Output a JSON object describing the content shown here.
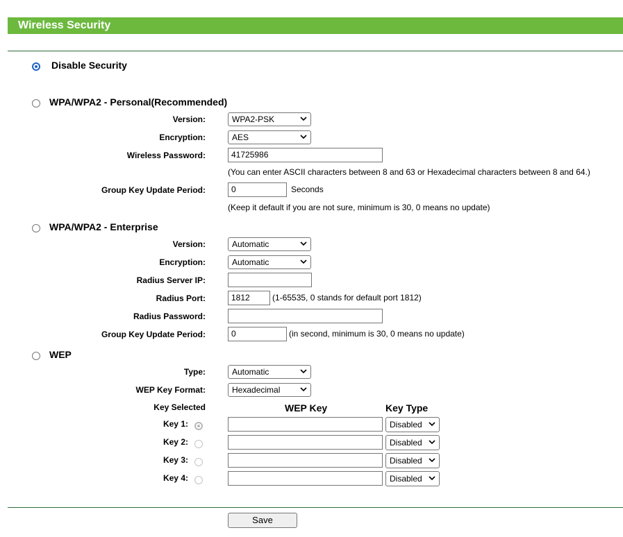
{
  "title": "Wireless Security",
  "disable": {
    "label": "Disable Security",
    "checked": true
  },
  "personal": {
    "label": "WPA/WPA2 - Personal(Recommended)",
    "version_label": "Version:",
    "version_value": "WPA2-PSK",
    "encryption_label": "Encryption:",
    "encryption_value": "AES",
    "password_label": "Wireless Password:",
    "password_value": "41725986",
    "password_note": "(You can enter ASCII characters between 8 and 63 or Hexadecimal characters between 8 and 64.)",
    "gkup_label": "Group Key Update Period:",
    "gkup_value": "0",
    "gkup_unit": "Seconds",
    "gkup_note": "(Keep it default if you are not sure, minimum is 30, 0 means no update)"
  },
  "enterprise": {
    "label": "WPA/WPA2 - Enterprise",
    "version_label": "Version:",
    "version_value": "Automatic",
    "encryption_label": "Encryption:",
    "encryption_value": "Automatic",
    "radius_ip_label": "Radius Server IP:",
    "radius_ip_value": "",
    "radius_port_label": "Radius Port:",
    "radius_port_value": "1812",
    "radius_port_note": "(1-65535, 0 stands for default port 1812)",
    "radius_pw_label": "Radius Password:",
    "radius_pw_value": "",
    "gkup_label": "Group Key Update Period:",
    "gkup_value": "0",
    "gkup_note": "(in second, minimum is 30, 0 means no update)"
  },
  "wep": {
    "label": "WEP",
    "type_label": "Type:",
    "type_value": "Automatic",
    "format_label": "WEP Key Format:",
    "format_value": "Hexadecimal",
    "key_selected_header": "Key Selected",
    "wep_key_header": "WEP Key",
    "key_type_header": "Key Type",
    "keys": [
      {
        "label": "Key 1:",
        "value": "",
        "type": "Disabled",
        "selected": true
      },
      {
        "label": "Key 2:",
        "value": "",
        "type": "Disabled",
        "selected": false
      },
      {
        "label": "Key 3:",
        "value": "",
        "type": "Disabled",
        "selected": false
      },
      {
        "label": "Key 4:",
        "value": "",
        "type": "Disabled",
        "selected": false
      }
    ]
  },
  "save_label": "Save",
  "colors": {
    "header_green": "#6cb93e",
    "divider_green": "#2e6a3a",
    "radio_blue": "#1f63c6"
  }
}
